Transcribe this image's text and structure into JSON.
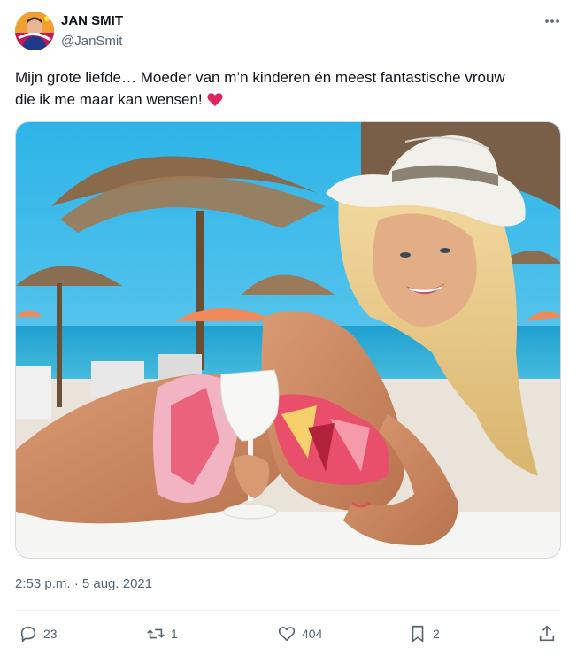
{
  "author": {
    "display_name": "JAN SMIT",
    "handle": "@JanSmit"
  },
  "tweet": {
    "text_line1": "Mijn grote liefde… Moeder van m’n kinderen én meest fantastische vrouw",
    "text_line2": "die ik me maar kan wensen!",
    "emoji": "❤️",
    "timestamp": "2:53 p.m. · 5 aug. 2021"
  },
  "stats": {
    "replies": "23",
    "retweets": "1",
    "likes": "404",
    "bookmarks": "2"
  },
  "icons": {
    "more": "more-dots-icon",
    "reply": "reply-bubble-icon",
    "retweet": "retweet-icon",
    "like": "heart-icon",
    "bookmark": "bookmark-icon",
    "share": "share-upload-icon"
  },
  "colors": {
    "text_primary": "#0f1419",
    "text_secondary": "#536471",
    "border": "#cfd9de",
    "heart": "#e0245e"
  }
}
